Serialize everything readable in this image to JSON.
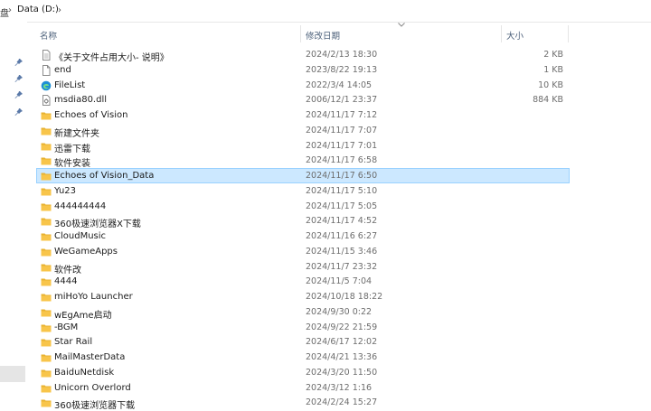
{
  "breadcrumb": {
    "cut_label": "盘",
    "location": "Data (D:)"
  },
  "columns": {
    "name": "名称",
    "date": "修改日期",
    "size": "大小"
  },
  "files": [
    {
      "name": "《关于文件占用大小- 说明》",
      "date": "2024/2/13 18:30",
      "size": "2 KB",
      "icon": "text-file-icon",
      "selected": false
    },
    {
      "name": "end",
      "date": "2023/8/22 19:13",
      "size": "1 KB",
      "icon": "blank-file-icon",
      "selected": false
    },
    {
      "name": "FileList",
      "date": "2022/3/4 14:05",
      "size": "10 KB",
      "icon": "edge-html-file-icon",
      "selected": false
    },
    {
      "name": "msdia80.dll",
      "date": "2006/12/1 23:37",
      "size": "884 KB",
      "icon": "dll-file-icon",
      "selected": false
    },
    {
      "name": "Echoes of Vision",
      "date": "2024/11/17 7:12",
      "size": "",
      "icon": "folder-icon",
      "selected": false
    },
    {
      "name": "新建文件夹",
      "date": "2024/11/17 7:07",
      "size": "",
      "icon": "folder-icon",
      "selected": false
    },
    {
      "name": "迅雷下载",
      "date": "2024/11/17 7:01",
      "size": "",
      "icon": "folder-icon",
      "selected": false
    },
    {
      "name": "软件安装",
      "date": "2024/11/17 6:58",
      "size": "",
      "icon": "folder-icon",
      "selected": false
    },
    {
      "name": "Echoes of Vision_Data",
      "date": "2024/11/17 6:50",
      "size": "",
      "icon": "folder-icon",
      "selected": true
    },
    {
      "name": "Yu23",
      "date": "2024/11/17 5:10",
      "size": "",
      "icon": "folder-icon",
      "selected": false
    },
    {
      "name": "444444444",
      "date": "2024/11/17 5:05",
      "size": "",
      "icon": "folder-icon",
      "selected": false
    },
    {
      "name": "360极速浏览器X下载",
      "date": "2024/11/17 4:52",
      "size": "",
      "icon": "folder-icon",
      "selected": false
    },
    {
      "name": "CloudMusic",
      "date": "2024/11/16 6:27",
      "size": "",
      "icon": "folder-icon",
      "selected": false
    },
    {
      "name": "WeGameApps",
      "date": "2024/11/15 3:46",
      "size": "",
      "icon": "folder-icon",
      "selected": false
    },
    {
      "name": "软件改",
      "date": "2024/11/7 23:32",
      "size": "",
      "icon": "folder-icon",
      "selected": false
    },
    {
      "name": "4444",
      "date": "2024/11/5 7:04",
      "size": "",
      "icon": "folder-icon",
      "selected": false
    },
    {
      "name": "miHoYo Launcher",
      "date": "2024/10/18 18:22",
      "size": "",
      "icon": "folder-icon",
      "selected": false
    },
    {
      "name": "wEgAme启动",
      "date": "2024/9/30 0:22",
      "size": "",
      "icon": "folder-icon",
      "selected": false
    },
    {
      "name": "-BGM",
      "date": "2024/9/22 21:59",
      "size": "",
      "icon": "folder-icon",
      "selected": false
    },
    {
      "name": "Star Rail",
      "date": "2024/6/17 12:02",
      "size": "",
      "icon": "folder-icon",
      "selected": false
    },
    {
      "name": "MailMasterData",
      "date": "2024/4/21 13:36",
      "size": "",
      "icon": "folder-icon",
      "selected": false
    },
    {
      "name": "BaiduNetdisk",
      "date": "2024/3/20 11:50",
      "size": "",
      "icon": "folder-icon",
      "selected": false
    },
    {
      "name": "Unicorn Overlord",
      "date": "2024/3/12 1:16",
      "size": "",
      "icon": "folder-icon",
      "selected": false
    },
    {
      "name": "360极速浏览器下载",
      "date": "2024/2/24 15:27",
      "size": "",
      "icon": "folder-icon",
      "selected": false
    }
  ],
  "colors": {
    "selection_bg": "#cce8ff",
    "selection_border": "#99d1ff",
    "folder_yellow": "#f8c54a",
    "header_text": "#4c607a"
  }
}
